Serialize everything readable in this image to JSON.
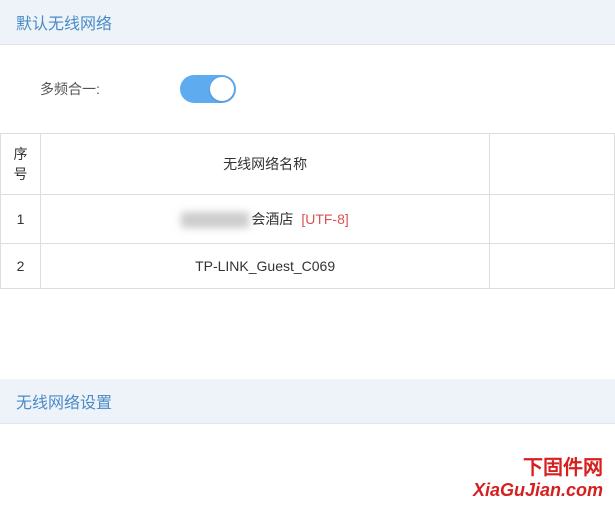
{
  "sections": {
    "default_wireless": {
      "title": "默认无线网络",
      "multiband_label": "多频合一:",
      "multiband_on": true
    },
    "wireless_settings": {
      "title": "无线网络设置"
    }
  },
  "table": {
    "headers": {
      "index": "序号",
      "name": "无线网络名称",
      "action": ""
    },
    "rows": [
      {
        "index": "1",
        "name_suffix": "会酒店",
        "encoding": "[UTF-8]"
      },
      {
        "index": "2",
        "name": "TP-LINK_Guest_C069"
      }
    ]
  },
  "watermark": {
    "line1": "下固件网",
    "line2": "XiaGuJian.com"
  }
}
